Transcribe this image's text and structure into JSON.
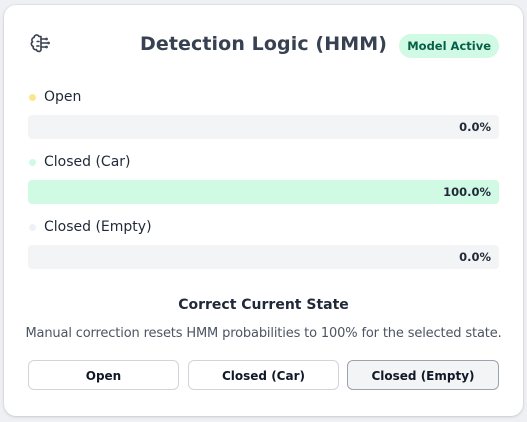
{
  "header": {
    "icon": "brain-icon",
    "title": "Detection Logic (HMM)",
    "badge": "Model Active"
  },
  "states": [
    {
      "label": "Open",
      "value_text": "0.0%",
      "probability": 0.0,
      "dot_color": "#fde68a",
      "fill_color": "#fef3c7"
    },
    {
      "label": "Closed (Car)",
      "value_text": "100.0%",
      "probability": 1.0,
      "dot_color": "#d1fae5",
      "fill_color": "#d1fae5"
    },
    {
      "label": "Closed (Empty)",
      "value_text": "0.0%",
      "probability": 0.0,
      "dot_color": "#eef2f7",
      "fill_color": "#e5e7eb"
    }
  ],
  "correction": {
    "title": "Correct Current State",
    "description": "Manual correction resets HMM probabilities to 100% for the selected state.",
    "buttons": [
      {
        "label": "Open",
        "selected": false
      },
      {
        "label": "Closed (Car)",
        "selected": false
      },
      {
        "label": "Closed (Empty)",
        "selected": true
      }
    ]
  },
  "colors": {
    "badge_bg": "#d1fae5",
    "badge_text": "#065f46",
    "bar_track": "#f3f4f6"
  }
}
